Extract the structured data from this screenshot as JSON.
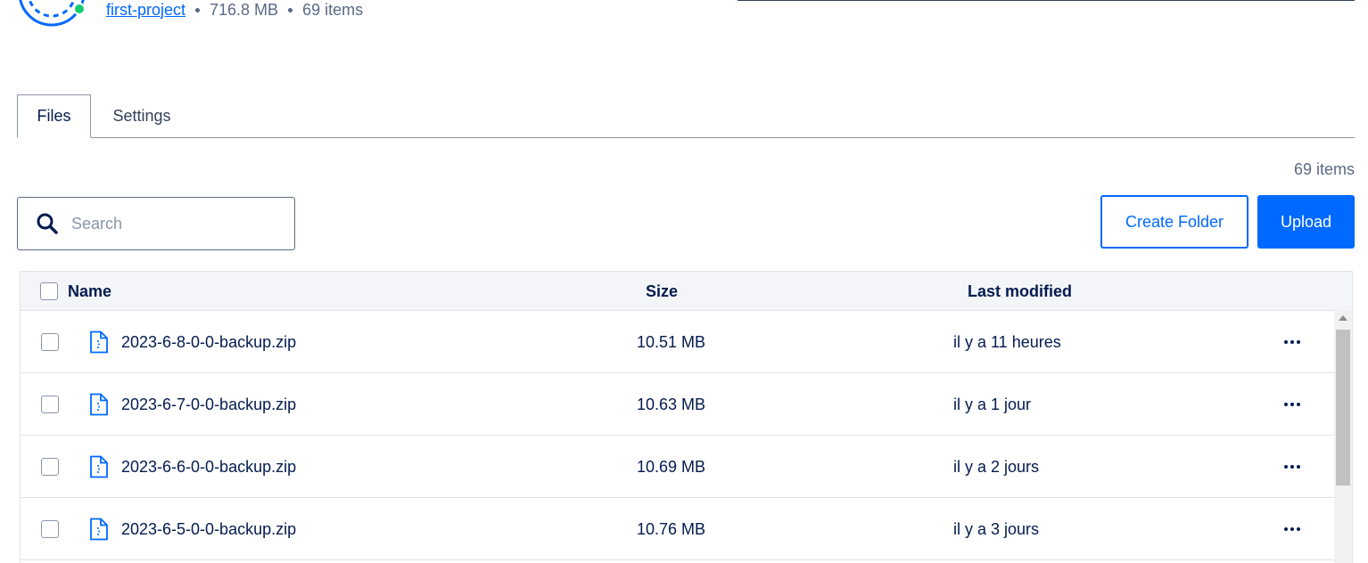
{
  "project": {
    "name": "first-project",
    "size": "716.8 MB",
    "items": "69 items"
  },
  "tabs": [
    {
      "label": "Files",
      "active": true
    },
    {
      "label": "Settings",
      "active": false
    }
  ],
  "toolbar": {
    "item_count": "69 items",
    "search_placeholder": "Search",
    "create_folder_label": "Create Folder",
    "upload_label": "Upload"
  },
  "table": {
    "columns": [
      "Name",
      "Size",
      "Last modified"
    ],
    "rows": [
      {
        "name": "2023-6-8-0-0-backup.zip",
        "size": "10.51 MB",
        "modified": "il y a 11 heures"
      },
      {
        "name": "2023-6-7-0-0-backup.zip",
        "size": "10.63 MB",
        "modified": "il y a 1 jour"
      },
      {
        "name": "2023-6-6-0-0-backup.zip",
        "size": "10.69 MB",
        "modified": "il y a 2 jours"
      },
      {
        "name": "2023-6-5-0-0-backup.zip",
        "size": "10.76 MB",
        "modified": "il y a 3 jours"
      }
    ]
  },
  "colors": {
    "accent": "#0069ff",
    "text": "#031b4e",
    "online": "#15cd72"
  }
}
